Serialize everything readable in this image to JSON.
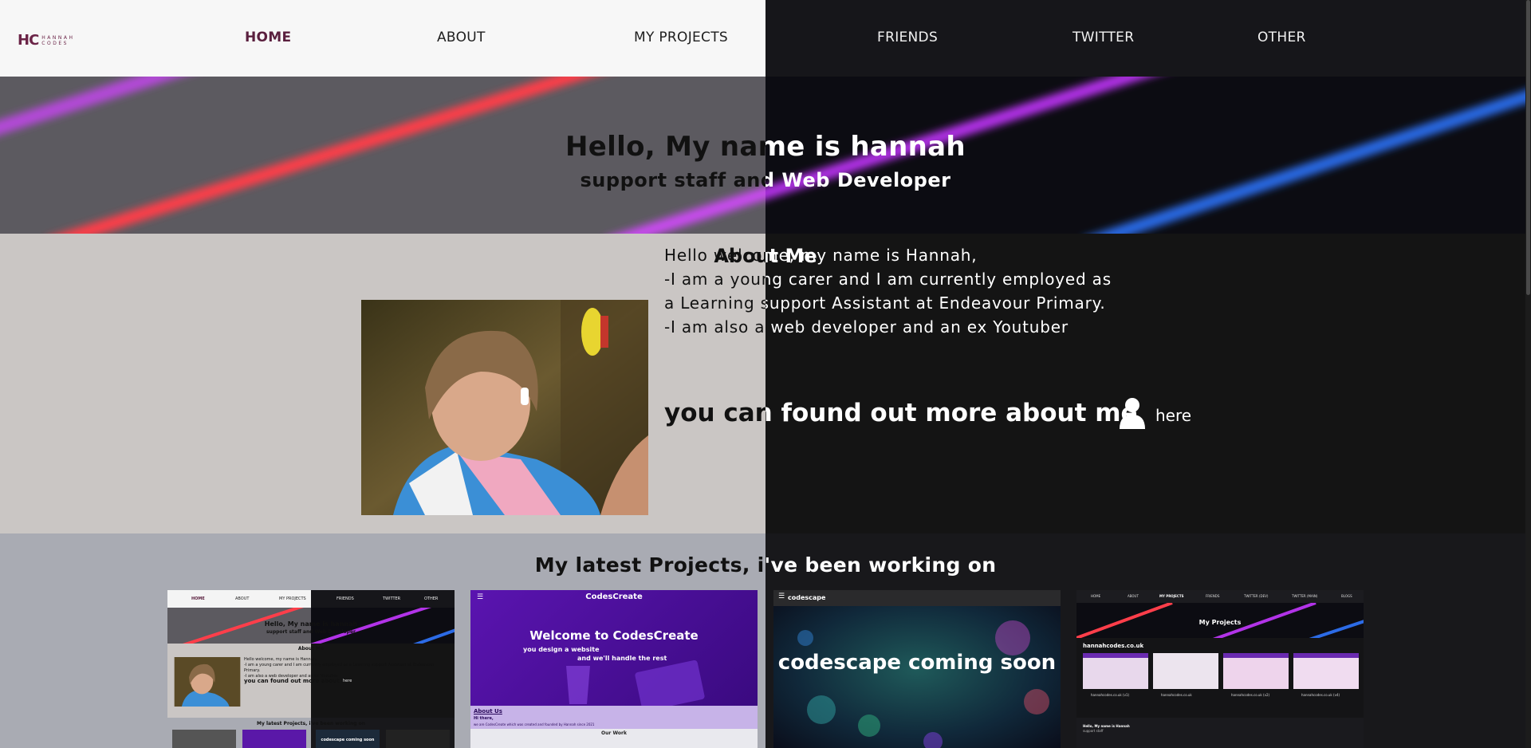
{
  "logo": {
    "mark": "HC",
    "word1": "HANNAH",
    "word2": "CODES"
  },
  "nav": {
    "items": [
      {
        "label": "HOME"
      },
      {
        "label": "ABOUT"
      },
      {
        "label": "MY PROJECTS"
      },
      {
        "label": "FRIENDS"
      },
      {
        "label": "TWITTER"
      },
      {
        "label": "OTHER"
      }
    ]
  },
  "hero": {
    "title": "Hello, My name is hannah",
    "subtitle": "support staff and Web Developer"
  },
  "about": {
    "title": "About Me",
    "lines": [
      "Hello welcome, my name is Hannah,",
      "-I am a young carer and I am currently employed as",
      "a Learning support Assistant at Endeavour Primary.",
      "-I am also a web developer and an ex Youtuber"
    ],
    "more": "you can found out more about me",
    "link": "here"
  },
  "projects": {
    "title": "My latest Projects, i've been working on",
    "cards": [
      {
        "name": "hannahcodes site preview",
        "nav": [
          "HOME",
          "ABOUT",
          "MY PROJECTS",
          "FRIENDS",
          "TWITTER",
          "OTHER"
        ],
        "hero_title": "Hello, My name is hannah",
        "hero_sub": "support staff and Web Developer",
        "about_title": "About Me",
        "line1": "Hello welcome, my name is Hannah,",
        "line2": "-I am a young carer and I am currently employed as a Learning support Assistant at Endeavour Primary.",
        "line3": "-I am also a web developer and an ex Youtuber",
        "more": "you can found out more about me",
        "link": "here",
        "projects_title": "My latest Projects, i've been working on",
        "soon": "codescape coming soon"
      },
      {
        "name": "CodesCreate",
        "brand": "CodesCreate",
        "welcome": "Welcome to CodesCreate",
        "design": "you design a website",
        "handle": "and we'll handle the rest",
        "about_title": "About Us",
        "hi": "Hi there,",
        "about_line": "we are CodesCreate which was created and founded by Hannah since 2021",
        "our_work": "Our Work"
      },
      {
        "name": "codescape",
        "brand": "codescape",
        "soon": "codescape coming soon"
      },
      {
        "name": "My Projects",
        "nav": [
          "HOME",
          "ABOUT",
          "MY PROJECTS",
          "FRIENDS",
          "TWITTER (DEV)",
          "TWITTER (MAIN)",
          "BLOGS"
        ],
        "title": "My Projects",
        "site": "hannahcodes.co.uk",
        "thumbs": [
          "hannahcodes.co.uk (v1)",
          "hannahcodes.co.uk",
          "hannahcodes.co.uk (v2)",
          "hannahcodes.co.uk (v4)"
        ],
        "mini_title": "Hello, My name is Hannah",
        "mini_sub": "support staff"
      }
    ]
  },
  "colors": {
    "light_nav": "#f7f7f7",
    "dark_nav": "#16161a",
    "accent": "#6b2447",
    "about_light": "#cac6c4",
    "about_dark": "#141414",
    "projects_light": "#a9abb3",
    "projects_dark": "#18181b"
  },
  "icons": {
    "person": "person-icon",
    "menu": "menu-icon",
    "external": "external-link-icon"
  }
}
